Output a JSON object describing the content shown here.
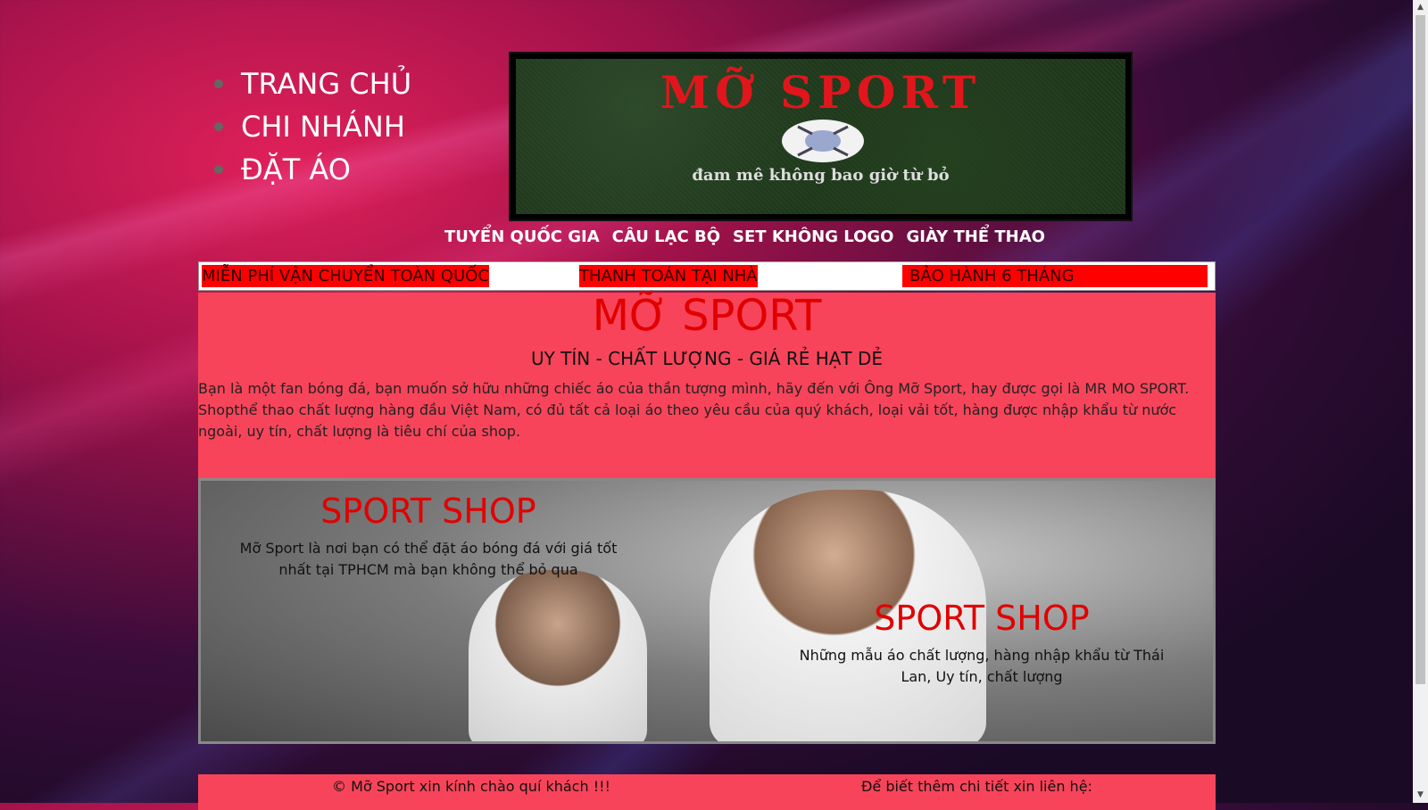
{
  "top_nav": {
    "items": [
      "TRANG CHỦ",
      "CHI NHÁNH",
      "ĐẶT ÁO"
    ]
  },
  "banner": {
    "title": "MỠ SPORT",
    "tagline": "đam mê không bao giờ từ bỏ"
  },
  "category_nav": {
    "items": [
      "TUYỂN QUỐC GIA",
      "CÂU LẠC BỘ",
      "SET KHÔNG LOGO",
      "GIÀY THỂ THAO"
    ]
  },
  "promo": {
    "items": [
      "MIỄN PHÍ VẬN CHUYỂN TOÀN QUỐC",
      "THANH TOÁN TẠI NHÀ",
      "BẢO HÀNH 6 THÁNG"
    ]
  },
  "intro": {
    "title": "MỠ SPORT",
    "subtitle": "UY TÍN - CHẤT LƯỢNG - GIÁ RẺ HẠT DẺ",
    "paragraph": "Bạn là một fan bóng đá, bạn muốn sở hữu những chiếc áo của thần tượng mình, hãy đến với Ông Mỡ Sport, hay được gọi là MR MO SPORT. Shopthể thao chất lượng hàng đầu Việt Nam, có đủ tất cả loại áo theo yêu cầu của quý khách, loại vải tốt, hàng được nhập khẩu từ nước ngoài, uy tín, chất lượng là tiêu chí của shop."
  },
  "hero": {
    "left": {
      "title": "SPORT SHOP",
      "text": "Mỡ Sport là nơi bạn có thể đặt áo bóng đá với giá tốt nhất tại TPHCM mà bạn không thể bỏ qua"
    },
    "right": {
      "title": "SPORT SHOP",
      "text": "Những mẫu áo chất lượng, hàng nhập khẩu từ Thái Lan, Uy tín, chất lượng"
    }
  },
  "footer": {
    "left": "© Mỡ Sport xin kính chào quí khách !!!",
    "right": "Để biết thêm chi tiết xin liên hệ:"
  },
  "colors": {
    "accent_red": "#e10000",
    "panel_pink": "#f8445a",
    "promo_red": "#ff0000"
  }
}
